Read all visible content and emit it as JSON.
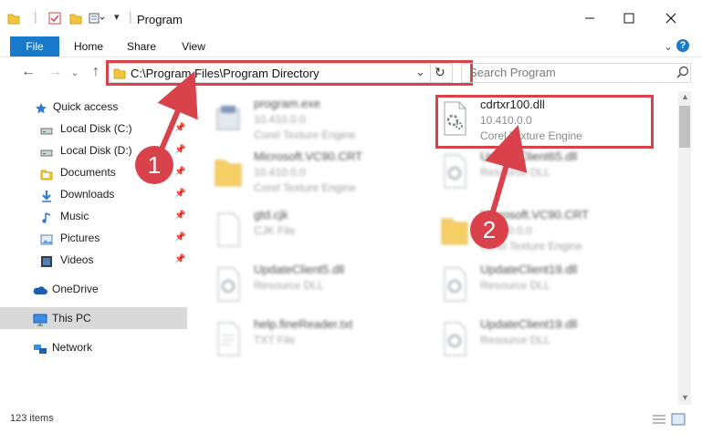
{
  "window": {
    "title": "Program"
  },
  "ribbon": {
    "tabs": [
      "File",
      "Home",
      "Share",
      "View"
    ]
  },
  "nav": {
    "back": "←",
    "forward": "→",
    "up": "↑",
    "refresh": "↻",
    "dropdown": "⌄",
    "address": "C:\\Program Files\\Program Directory",
    "search_placeholder": "Search Program"
  },
  "sidebar": {
    "items": [
      {
        "label": "Quick access",
        "icon": "star-icon",
        "pinned": false
      },
      {
        "label": "Local Disk (C:)",
        "icon": "drive-icon",
        "pinned": true
      },
      {
        "label": "Local Disk (D:)",
        "icon": "drive-icon",
        "pinned": true
      },
      {
        "label": "Documents",
        "icon": "documents-icon",
        "pinned": true
      },
      {
        "label": "Downloads",
        "icon": "download-icon",
        "pinned": true
      },
      {
        "label": "Music",
        "icon": "music-icon",
        "pinned": true
      },
      {
        "label": "Pictures",
        "icon": "pictures-icon",
        "pinned": true
      },
      {
        "label": "Videos",
        "icon": "videos-icon",
        "pinned": true
      },
      {
        "label": "OneDrive",
        "icon": "cloud-icon",
        "pinned": false
      },
      {
        "label": "This PC",
        "icon": "computer-icon",
        "pinned": false
      },
      {
        "label": "Network",
        "icon": "network-icon",
        "pinned": false
      }
    ]
  },
  "files": {
    "left": [
      {
        "name": "program.exe",
        "line2": "10.410.0.0",
        "line3": "Corel Texture Engine"
      },
      {
        "name": "Microsoft.VC90.CRT",
        "line2": "10.410.0.0",
        "line3": "Corel Texture Engine"
      },
      {
        "name": "gtd.cjk",
        "line2": "CJK File",
        "line3": ""
      },
      {
        "name": "UpdateClient5.dll",
        "line2": "Resource DLL",
        "line3": ""
      },
      {
        "name": "help.fineReader.txt",
        "line2": "TXT File",
        "line3": ""
      }
    ],
    "right": [
      {
        "name": "cdrtxr100.dll",
        "line2": "10.410.0.0",
        "line3": "Corel Texture Engine"
      },
      {
        "name": "UpdateClient65.dll",
        "line2": "Resource DLL",
        "line3": ""
      },
      {
        "name": "Microsoft.VC90.CRT",
        "line2": "10.410.0.0",
        "line3": "Corel Texture Engine"
      },
      {
        "name": "UpdateClient19.dll",
        "line2": "Resource DLL",
        "line3": ""
      },
      {
        "name": "UpdateClient19.dll",
        "line2": "Resource DLL",
        "line3": ""
      }
    ]
  },
  "annotations": {
    "step1": "1",
    "step2": "2"
  },
  "status": {
    "count": "123 items"
  },
  "colors": {
    "accent": "#1979ca",
    "highlight": "#d9424b"
  }
}
